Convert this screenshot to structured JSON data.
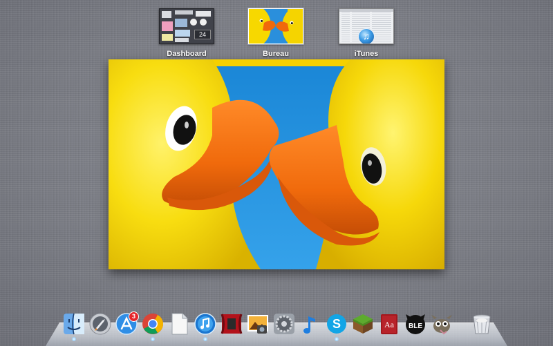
{
  "spaces": [
    {
      "label": "Dashboard"
    },
    {
      "label": "Bureau",
      "active": true
    },
    {
      "label": "iTunes"
    }
  ],
  "dashboard_thumb": {
    "clock_text": "24"
  },
  "main_preview": {
    "subject": "rubber-ducks-wallpaper"
  },
  "dock": {
    "items": [
      {
        "name": "finder-icon"
      },
      {
        "name": "launchpad-icon"
      },
      {
        "name": "app-store-icon",
        "badge": "3"
      },
      {
        "name": "chrome-icon"
      },
      {
        "name": "document-icon"
      },
      {
        "name": "itunes-icon"
      },
      {
        "name": "photo-booth-icon"
      },
      {
        "name": "iphoto-icon"
      },
      {
        "name": "system-preferences-icon"
      },
      {
        "name": "music-note-icon"
      },
      {
        "name": "skype-icon"
      },
      {
        "name": "minecraft-icon"
      },
      {
        "name": "dictionary-icon",
        "label": "Aa"
      },
      {
        "name": "ble-icon",
        "label": "BLE"
      },
      {
        "name": "gimp-icon"
      },
      {
        "name": "trash-icon"
      }
    ]
  },
  "colors": {
    "accent": "#3c9be6",
    "desktop_bg": "#7c7e86",
    "sky": "#1e88d8",
    "duck_yellow": "#f5d000",
    "beak_orange": "#f06a0c"
  }
}
